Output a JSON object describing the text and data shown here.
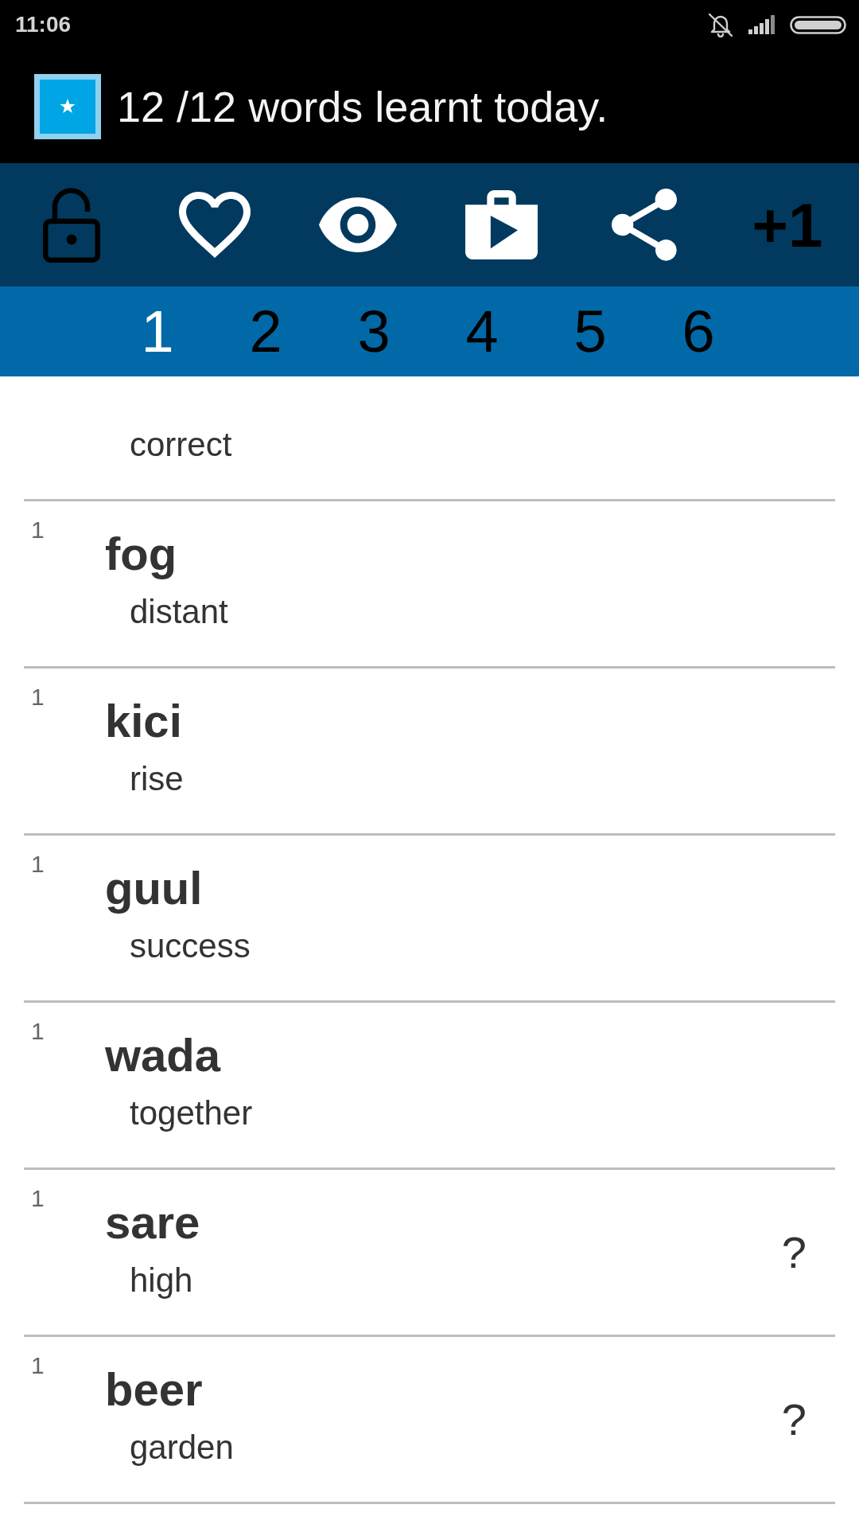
{
  "status_bar": {
    "time": "11:06"
  },
  "title_bar": {
    "title": "12 /12 words learnt today."
  },
  "toolbar": {
    "plus_button": "+1"
  },
  "tabs": [
    {
      "label": "1",
      "selected": true
    },
    {
      "label": "2",
      "selected": false
    },
    {
      "label": "3",
      "selected": false
    },
    {
      "label": "4",
      "selected": false
    },
    {
      "label": "5",
      "selected": false
    },
    {
      "label": "6",
      "selected": false
    }
  ],
  "list": {
    "rows": [
      {
        "kind": "partial",
        "meaning": "correct"
      },
      {
        "kind": "word",
        "number": "1",
        "word": "fog",
        "meaning": "distant"
      },
      {
        "kind": "word",
        "number": "1",
        "word": "kici",
        "meaning": "rise"
      },
      {
        "kind": "word",
        "number": "1",
        "word": "guul",
        "meaning": "success"
      },
      {
        "kind": "word",
        "number": "1",
        "word": "wada",
        "meaning": "together"
      },
      {
        "kind": "word",
        "number": "1",
        "word": "sare",
        "meaning": "high",
        "hint": "?"
      },
      {
        "kind": "word",
        "number": "1",
        "word": "beer",
        "meaning": "garden",
        "hint": "?"
      }
    ]
  }
}
